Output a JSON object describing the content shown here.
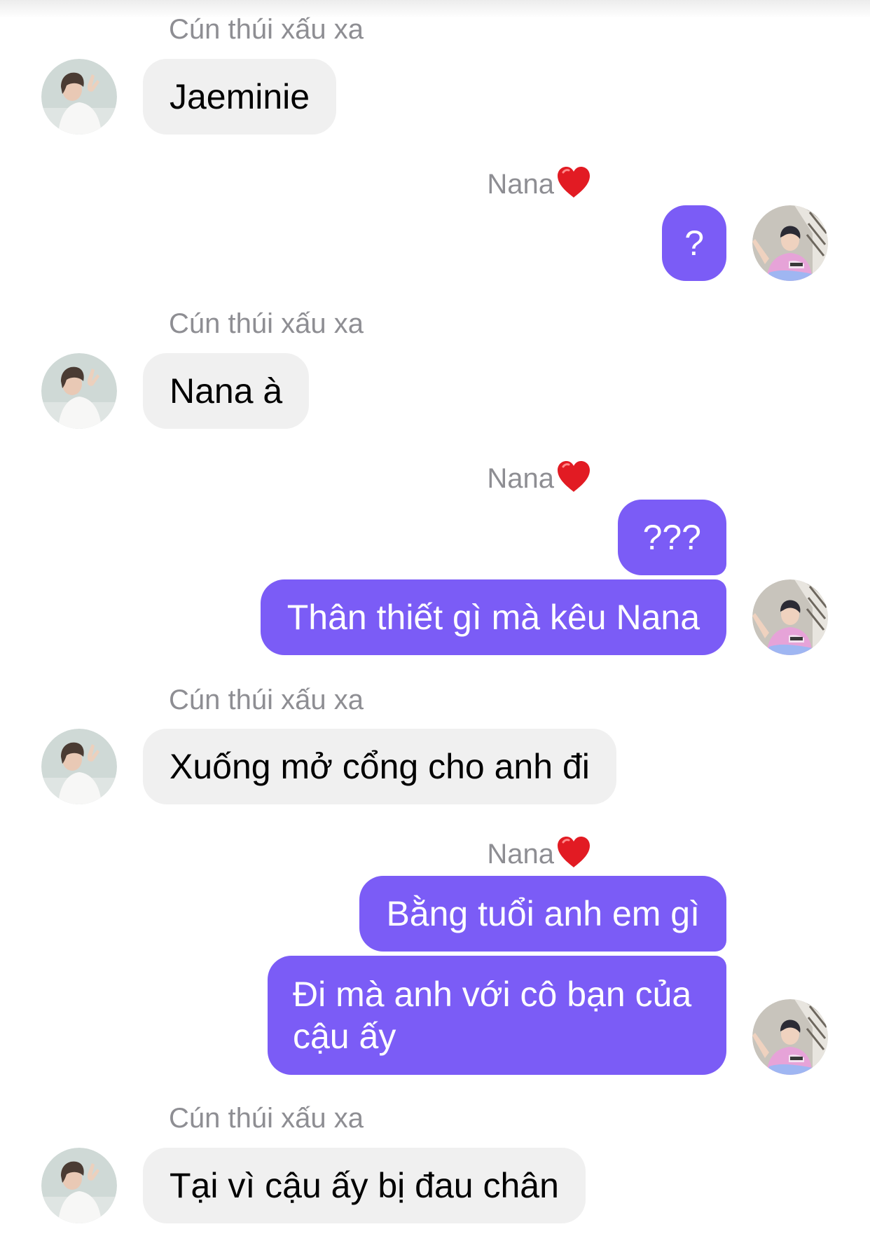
{
  "contacts": {
    "other_name": "Cún thúi xấu xa",
    "me_name": "Nana",
    "me_heart_icon": "red-heart-emoji",
    "me_bubble_color": "#7b5cf6",
    "other_bubble_color": "#f0f0f0"
  },
  "messages": [
    {
      "sender": "Cún thúi xấu xa",
      "text": "Jaeminie"
    },
    {
      "sender": "Nana",
      "text": "?"
    },
    {
      "sender": "Cún thúi xấu xa",
      "text": "Nana à"
    },
    {
      "sender": "Nana",
      "text": "???"
    },
    {
      "sender": "Nana",
      "text": "Thân thiết gì mà kêu Nana"
    },
    {
      "sender": "Cún thúi xấu xa",
      "text": "Xuống mở cổng cho anh đi"
    },
    {
      "sender": "Nana",
      "text": "Bằng tuổi anh em gì"
    },
    {
      "sender": "Nana",
      "line1": "Đi mà anh với cô bạn của",
      "line2": "cậu ấy"
    },
    {
      "sender": "Cún thúi xấu xa",
      "text": "Tại vì cậu ấy bị đau chân"
    }
  ]
}
